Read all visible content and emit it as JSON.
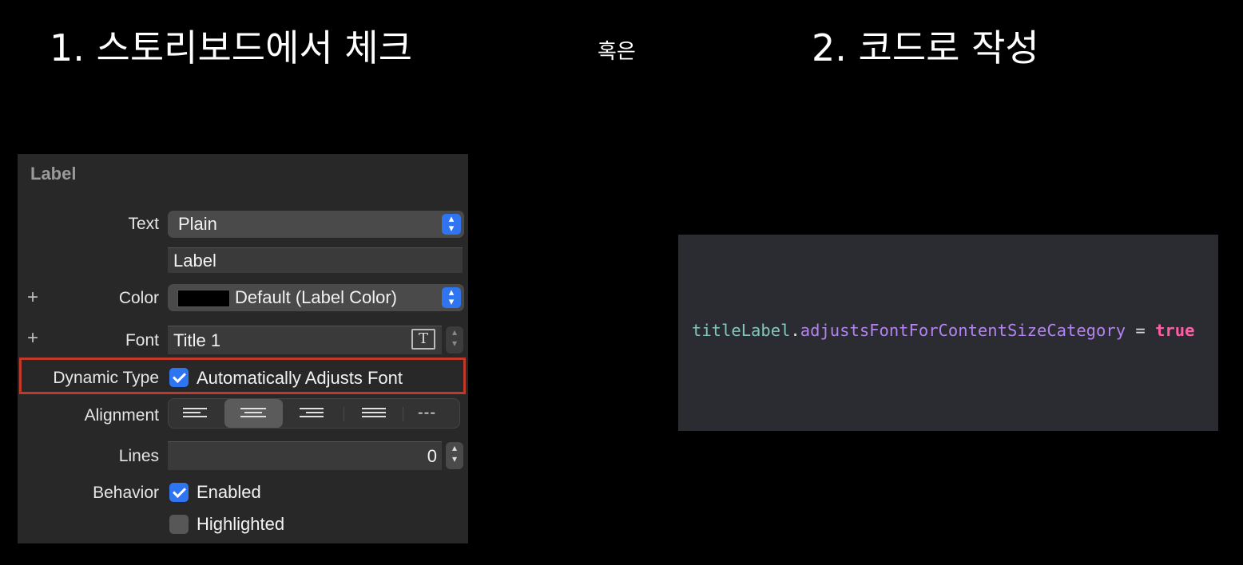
{
  "headings": {
    "left": "1. 스토리보드에서 체크",
    "separator": "혹은",
    "right": "2. 코드로 작성"
  },
  "inspector": {
    "section_title": "Label",
    "text_row": {
      "label": "Text",
      "value": "Plain"
    },
    "text_field_value": "Label",
    "color_row": {
      "plus": "+",
      "label": "Color",
      "value": "Default (Label Color)",
      "swatch_color": "#000000"
    },
    "font_row": {
      "plus": "+",
      "label": "Font",
      "value": "Title 1",
      "font_icon": "T"
    },
    "dynamic_type_row": {
      "label": "Dynamic Type",
      "checkbox_label": "Automatically Adjusts Font",
      "checked": true
    },
    "alignment_row": {
      "label": "Alignment",
      "options": [
        "left",
        "center",
        "right",
        "justified",
        "natural"
      ],
      "selected": "center",
      "natural_glyph": "---"
    },
    "lines_row": {
      "label": "Lines",
      "value": "0"
    },
    "behavior_row": {
      "label": "Behavior",
      "enabled": {
        "label": "Enabled",
        "checked": true
      },
      "highlighted": {
        "label": "Highlighted",
        "checked": false
      }
    },
    "stepper_glyphs": {
      "up": "▴",
      "down": "▾"
    }
  },
  "code": {
    "object": "titleLabel",
    "dot": ".",
    "property": "adjustsFontForContentSizeCategory",
    "operator": " = ",
    "value": "true"
  },
  "colors": {
    "highlight_border": "#c0392b",
    "checkbox_accent": "#2f74f0",
    "code_background": "#2b2c31",
    "keyword": "#fc5fa3",
    "property": "#b583f0",
    "identifier": "#82c7b8"
  }
}
